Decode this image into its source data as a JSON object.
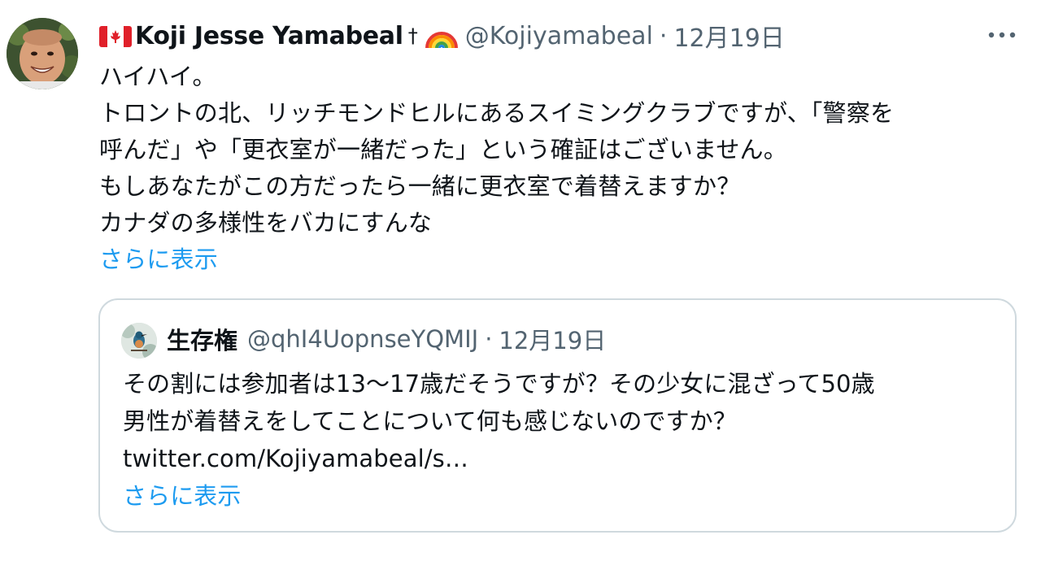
{
  "tweet": {
    "author": {
      "display_name": "Koji Jesse Yamabeal",
      "dagger": "†",
      "handle": "@Kojiyamabeal",
      "separator": "·",
      "date": "12月19日",
      "flag_icon": "canada-flag-icon",
      "badge_icon": "rainbow-icon"
    },
    "body_lines": [
      "ハイハイ。",
      "トロントの北、リッチモンドヒルにあるスイミングクラブですが、「警察を",
      "呼んだ」や「更衣室が一緒だった」という確証はございません。",
      "もしあなたがこの方だったら一緒に更衣室で着替えますか？",
      "カナダの多様性をバカにすんな"
    ],
    "show_more": "さらに表示",
    "more_icon": "more-horizontal-icon"
  },
  "quote": {
    "author": {
      "display_name": "生存権",
      "handle": "@qhI4UopnseYQMIJ",
      "separator": "·",
      "date": "12月19日"
    },
    "body_lines": [
      "その割には参加者は13〜17歳だそうですが？その少女に混ざって50歳",
      "男性が着替えをしてことについて何も感じないのですか？",
      "twitter.com/Kojiyamabeal/s…"
    ],
    "show_more": "さらに表示"
  },
  "colors": {
    "text": "#0f1419",
    "secondary": "#536471",
    "link": "#1d9bf0",
    "border": "#cfd9de"
  }
}
